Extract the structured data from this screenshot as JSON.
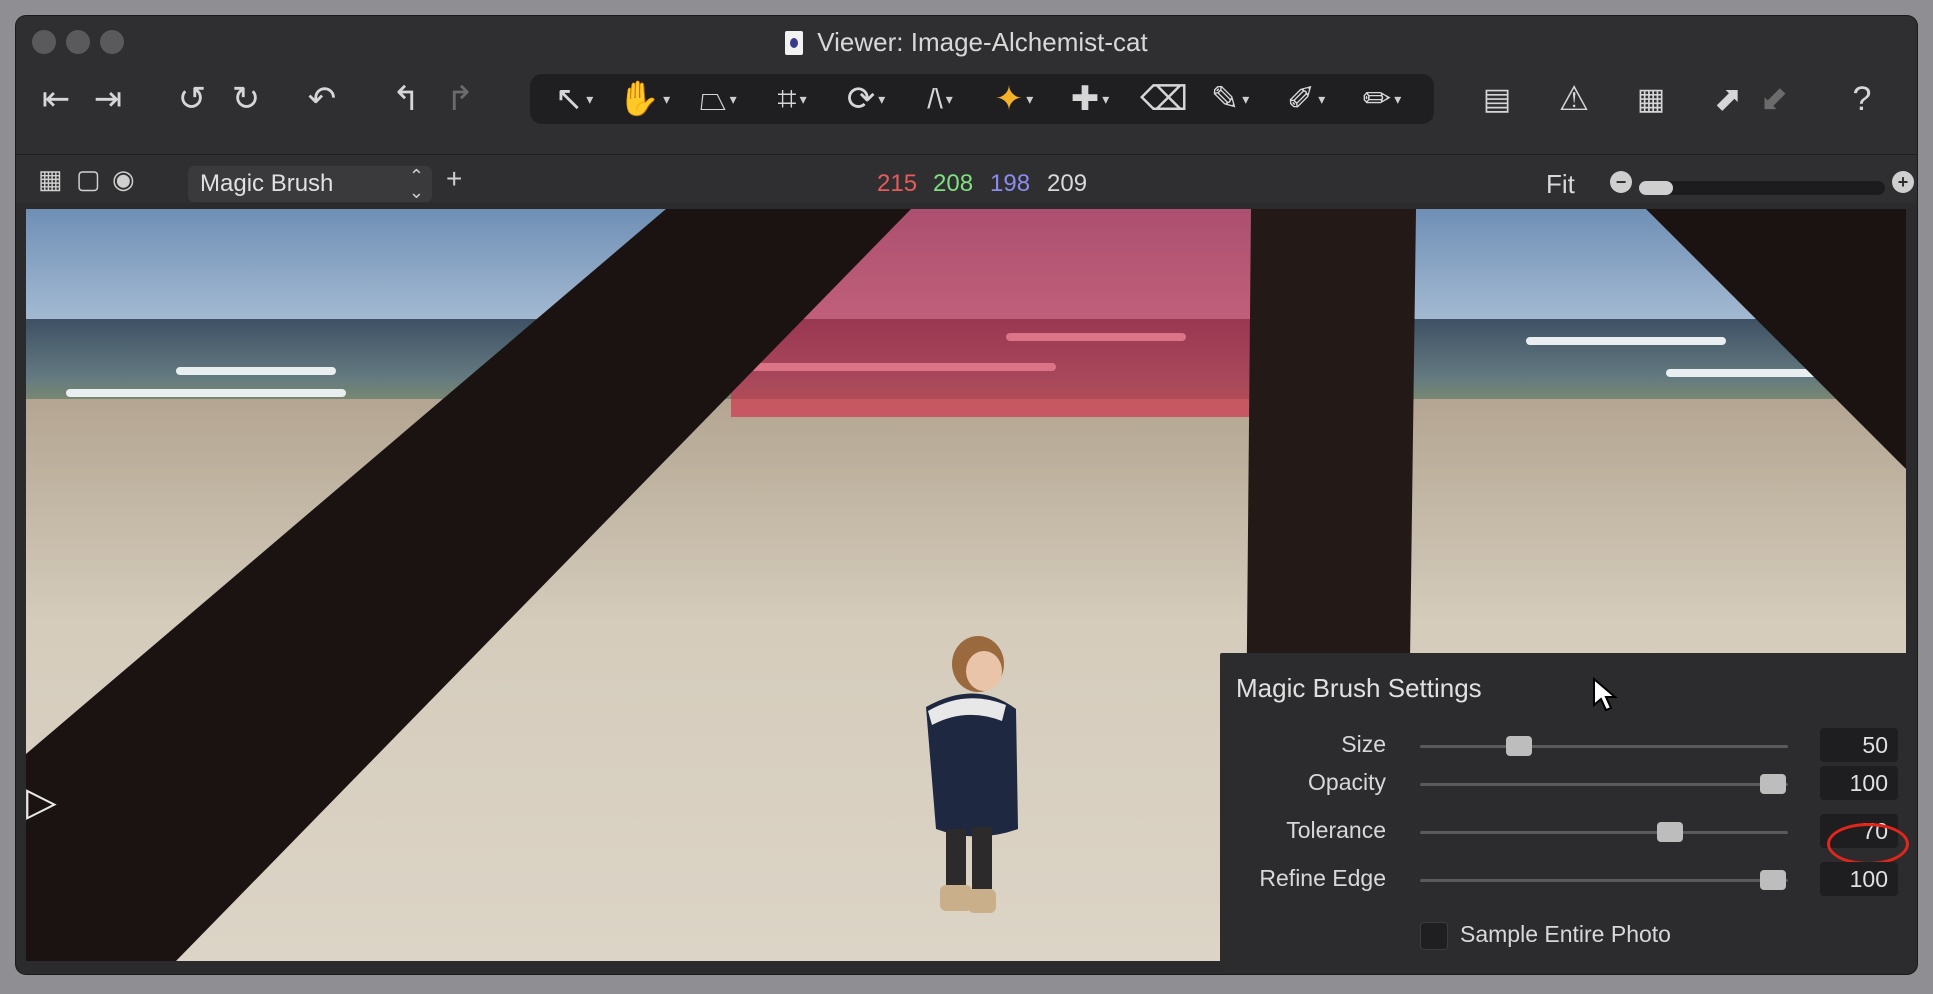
{
  "window": {
    "title": "Viewer: Image-Alchemist-cat"
  },
  "toolbar": {
    "icons": [
      "previous-image-icon",
      "next-image-icon",
      "rotate-left-icon",
      "rotate-right-icon",
      "undo-icon",
      "undo-step-icon",
      "redo-step-icon",
      "select-tool-icon",
      "pan-tool-icon",
      "keystone-tool-icon",
      "crop-tool-icon",
      "rotate-tool-icon",
      "straighten-tool-icon",
      "magic-brush-tool-icon",
      "healing-tool-icon",
      "eraser-tool-icon",
      "picker-tool-icon",
      "brush-tool-icon",
      "draw-mask-tool-icon",
      "grid-view-icon",
      "exposure-warning-icon",
      "grid-overlay-icon",
      "export-icon",
      "import-icon",
      "help-icon"
    ]
  },
  "subbar": {
    "tool_select": "Magic Brush",
    "rgb": {
      "r": "215",
      "g": "208",
      "b": "198",
      "l": "209"
    },
    "fit_label": "Fit",
    "zoom_level": 0.14
  },
  "colors": {
    "r": "#e85b5b",
    "g": "#7ee07e",
    "b": "#8b8bf0",
    "l": "#d8d8d8",
    "mask": "#d22846",
    "highlight": "#e3261b"
  },
  "magic_brush_settings": {
    "title": "Magic Brush Settings",
    "sliders": [
      {
        "label": "Size",
        "value": "50",
        "level": 0.27
      },
      {
        "label": "Opacity",
        "value": "100",
        "level": 0.96
      },
      {
        "label": "Tolerance",
        "value": "70",
        "level": 0.68
      },
      {
        "label": "Refine Edge",
        "value": "100",
        "level": 0.96
      }
    ],
    "sample_entire_photo": {
      "label": "Sample Entire Photo",
      "checked": false
    }
  }
}
